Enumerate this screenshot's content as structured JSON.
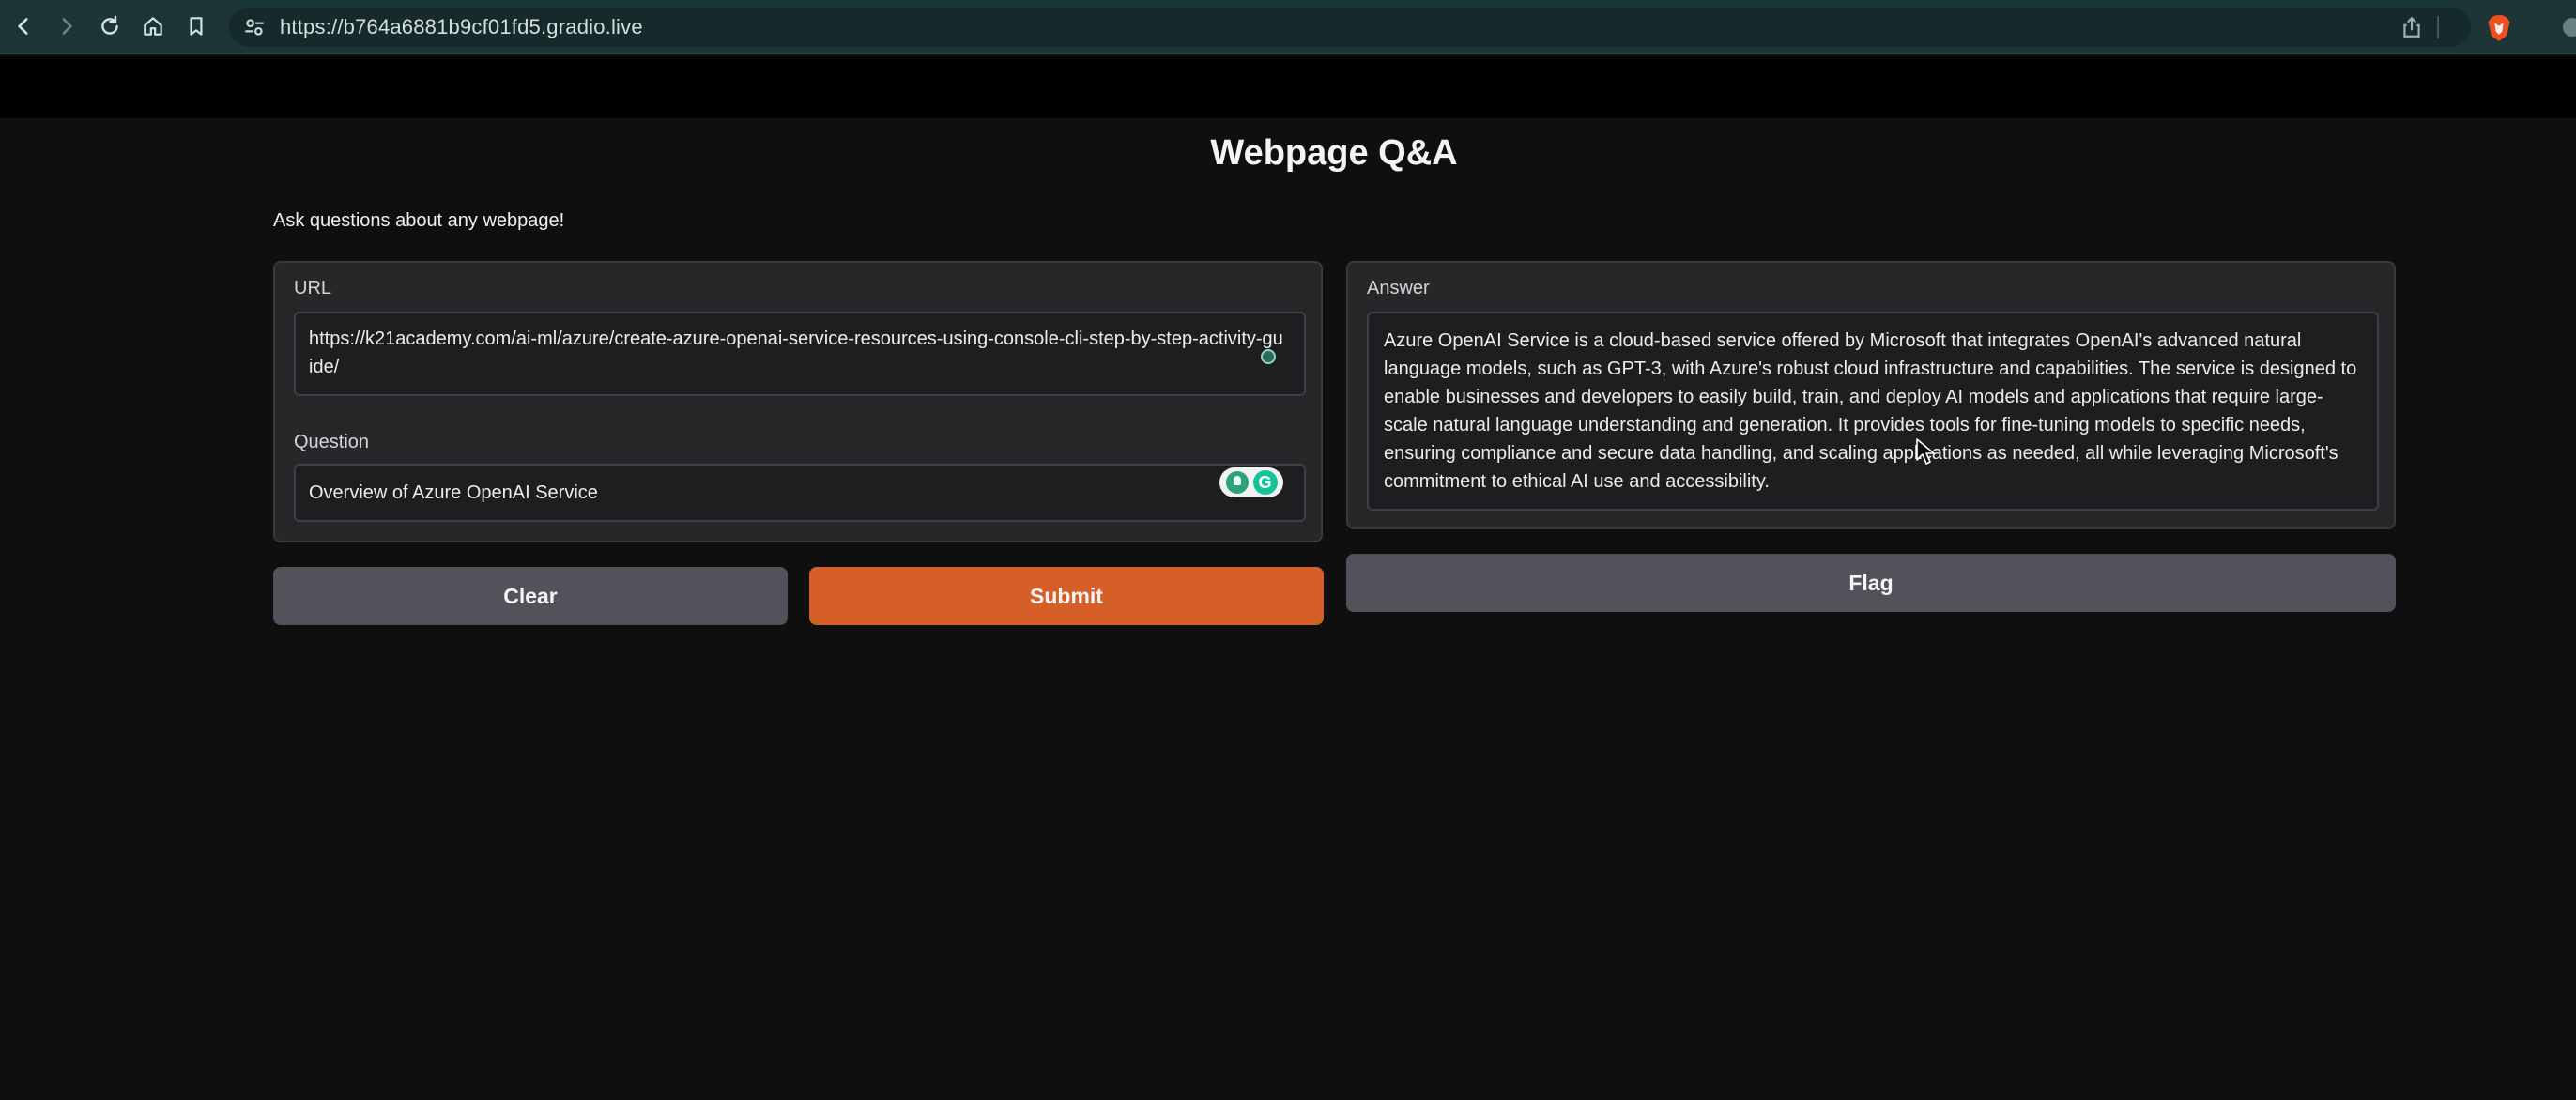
{
  "browser": {
    "url": "https://b764a6881b9cf01fd5.gradio.live"
  },
  "app": {
    "title": "Webpage Q&A",
    "subtitle": "Ask questions about any webpage!",
    "url_input": {
      "label": "URL",
      "value": "https://k21academy.com/ai-ml/azure/create-azure-openai-service-resources-using-console-cli-step-by-step-activity-guide/"
    },
    "question_input": {
      "label": "Question",
      "value": "Overview of Azure OpenAI Service"
    },
    "answer_output": {
      "label": "Answer",
      "value": "Azure OpenAI Service is a cloud-based service offered by Microsoft that integrates OpenAI's advanced natural language models, such as GPT-3, with Azure's robust cloud infrastructure and capabilities. The service is designed to enable businesses and developers to easily build, train, and deploy AI models and applications that require large-scale natural language understanding and generation. It provides tools for fine-tuning models to specific needs, ensuring compliance and secure data handling, and scaling applications as needed, all while leveraging Microsoft's commitment to ethical AI use and accessibility."
    },
    "buttons": {
      "clear": "Clear",
      "submit": "Submit",
      "flag": "Flag"
    }
  },
  "colors": {
    "chrome_bg": "#1c3638",
    "app_bg": "#0f0f10",
    "panel_bg": "#27272a",
    "secondary_button": "#52525b",
    "primary_button": "#d65f28"
  },
  "icons": [
    "back-icon",
    "forward-icon",
    "reload-icon",
    "home-icon",
    "bookmark-icon",
    "site-settings-icon",
    "share-icon",
    "brave-lion-icon",
    "grammar-assistant-icon",
    "mouse-cursor-icon"
  ]
}
